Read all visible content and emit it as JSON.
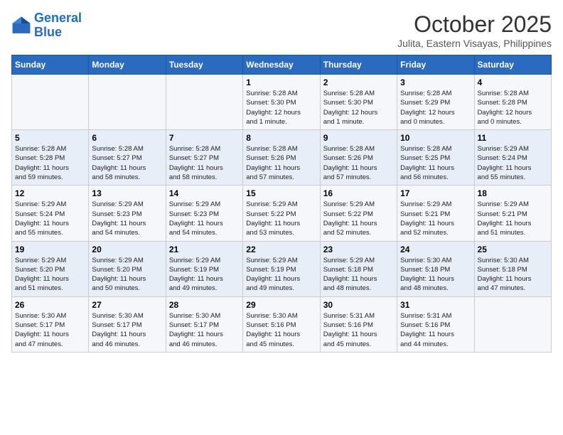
{
  "logo": {
    "line1": "General",
    "line2": "Blue"
  },
  "title": "October 2025",
  "subtitle": "Julita, Eastern Visayas, Philippines",
  "days_of_week": [
    "Sunday",
    "Monday",
    "Tuesday",
    "Wednesday",
    "Thursday",
    "Friday",
    "Saturday"
  ],
  "weeks": [
    [
      {
        "day": "",
        "details": ""
      },
      {
        "day": "",
        "details": ""
      },
      {
        "day": "",
        "details": ""
      },
      {
        "day": "1",
        "details": "Sunrise: 5:28 AM\nSunset: 5:30 PM\nDaylight: 12 hours\nand 1 minute."
      },
      {
        "day": "2",
        "details": "Sunrise: 5:28 AM\nSunset: 5:30 PM\nDaylight: 12 hours\nand 1 minute."
      },
      {
        "day": "3",
        "details": "Sunrise: 5:28 AM\nSunset: 5:29 PM\nDaylight: 12 hours\nand 0 minutes."
      },
      {
        "day": "4",
        "details": "Sunrise: 5:28 AM\nSunset: 5:28 PM\nDaylight: 12 hours\nand 0 minutes."
      }
    ],
    [
      {
        "day": "5",
        "details": "Sunrise: 5:28 AM\nSunset: 5:28 PM\nDaylight: 11 hours\nand 59 minutes."
      },
      {
        "day": "6",
        "details": "Sunrise: 5:28 AM\nSunset: 5:27 PM\nDaylight: 11 hours\nand 58 minutes."
      },
      {
        "day": "7",
        "details": "Sunrise: 5:28 AM\nSunset: 5:27 PM\nDaylight: 11 hours\nand 58 minutes."
      },
      {
        "day": "8",
        "details": "Sunrise: 5:28 AM\nSunset: 5:26 PM\nDaylight: 11 hours\nand 57 minutes."
      },
      {
        "day": "9",
        "details": "Sunrise: 5:28 AM\nSunset: 5:26 PM\nDaylight: 11 hours\nand 57 minutes."
      },
      {
        "day": "10",
        "details": "Sunrise: 5:28 AM\nSunset: 5:25 PM\nDaylight: 11 hours\nand 56 minutes."
      },
      {
        "day": "11",
        "details": "Sunrise: 5:29 AM\nSunset: 5:24 PM\nDaylight: 11 hours\nand 55 minutes."
      }
    ],
    [
      {
        "day": "12",
        "details": "Sunrise: 5:29 AM\nSunset: 5:24 PM\nDaylight: 11 hours\nand 55 minutes."
      },
      {
        "day": "13",
        "details": "Sunrise: 5:29 AM\nSunset: 5:23 PM\nDaylight: 11 hours\nand 54 minutes."
      },
      {
        "day": "14",
        "details": "Sunrise: 5:29 AM\nSunset: 5:23 PM\nDaylight: 11 hours\nand 54 minutes."
      },
      {
        "day": "15",
        "details": "Sunrise: 5:29 AM\nSunset: 5:22 PM\nDaylight: 11 hours\nand 53 minutes."
      },
      {
        "day": "16",
        "details": "Sunrise: 5:29 AM\nSunset: 5:22 PM\nDaylight: 11 hours\nand 52 minutes."
      },
      {
        "day": "17",
        "details": "Sunrise: 5:29 AM\nSunset: 5:21 PM\nDaylight: 11 hours\nand 52 minutes."
      },
      {
        "day": "18",
        "details": "Sunrise: 5:29 AM\nSunset: 5:21 PM\nDaylight: 11 hours\nand 51 minutes."
      }
    ],
    [
      {
        "day": "19",
        "details": "Sunrise: 5:29 AM\nSunset: 5:20 PM\nDaylight: 11 hours\nand 51 minutes."
      },
      {
        "day": "20",
        "details": "Sunrise: 5:29 AM\nSunset: 5:20 PM\nDaylight: 11 hours\nand 50 minutes."
      },
      {
        "day": "21",
        "details": "Sunrise: 5:29 AM\nSunset: 5:19 PM\nDaylight: 11 hours\nand 49 minutes."
      },
      {
        "day": "22",
        "details": "Sunrise: 5:29 AM\nSunset: 5:19 PM\nDaylight: 11 hours\nand 49 minutes."
      },
      {
        "day": "23",
        "details": "Sunrise: 5:29 AM\nSunset: 5:18 PM\nDaylight: 11 hours\nand 48 minutes."
      },
      {
        "day": "24",
        "details": "Sunrise: 5:30 AM\nSunset: 5:18 PM\nDaylight: 11 hours\nand 48 minutes."
      },
      {
        "day": "25",
        "details": "Sunrise: 5:30 AM\nSunset: 5:18 PM\nDaylight: 11 hours\nand 47 minutes."
      }
    ],
    [
      {
        "day": "26",
        "details": "Sunrise: 5:30 AM\nSunset: 5:17 PM\nDaylight: 11 hours\nand 47 minutes."
      },
      {
        "day": "27",
        "details": "Sunrise: 5:30 AM\nSunset: 5:17 PM\nDaylight: 11 hours\nand 46 minutes."
      },
      {
        "day": "28",
        "details": "Sunrise: 5:30 AM\nSunset: 5:17 PM\nDaylight: 11 hours\nand 46 minutes."
      },
      {
        "day": "29",
        "details": "Sunrise: 5:30 AM\nSunset: 5:16 PM\nDaylight: 11 hours\nand 45 minutes."
      },
      {
        "day": "30",
        "details": "Sunrise: 5:31 AM\nSunset: 5:16 PM\nDaylight: 11 hours\nand 45 minutes."
      },
      {
        "day": "31",
        "details": "Sunrise: 5:31 AM\nSunset: 5:16 PM\nDaylight: 11 hours\nand 44 minutes."
      },
      {
        "day": "",
        "details": ""
      }
    ]
  ]
}
